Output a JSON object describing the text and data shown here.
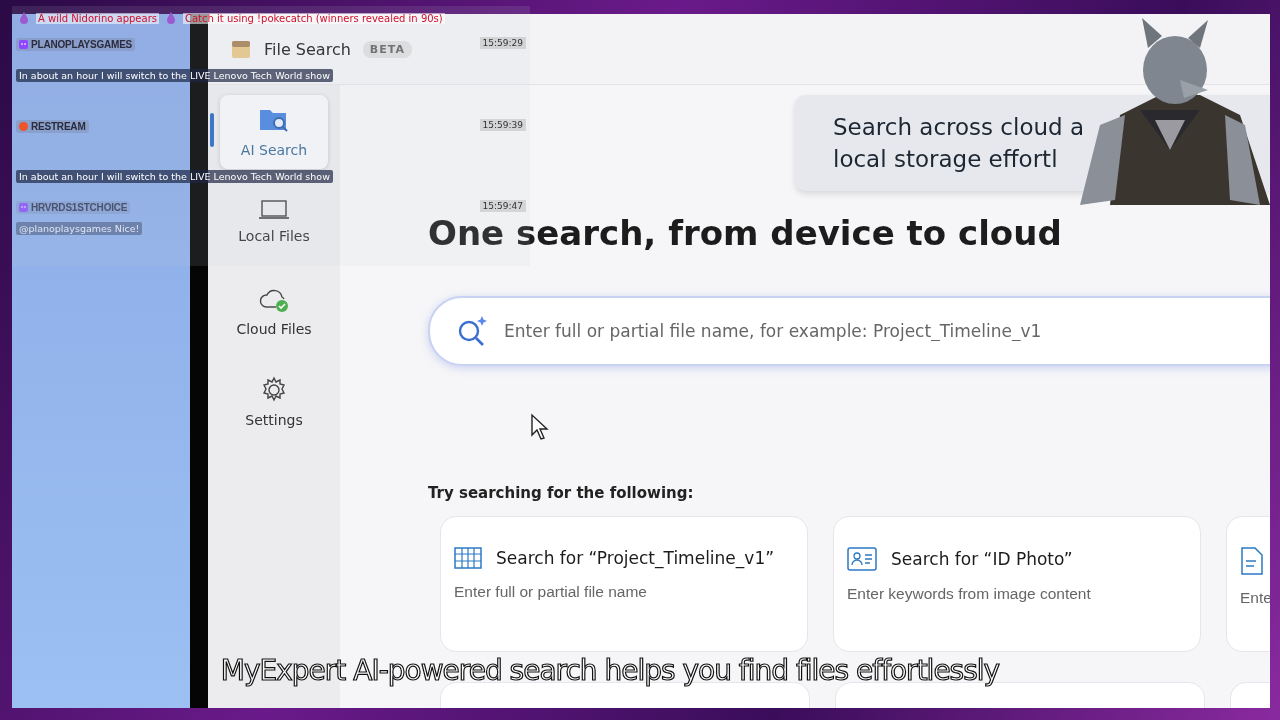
{
  "chat": {
    "alert": {
      "text": "A wild Nidorino appears",
      "text2": "Catch it using !pokecatch (winners revealed in 90s)"
    },
    "messages": [
      {
        "kind": "twitch",
        "user": "PLANOPLAYSGAMES",
        "time": "15:59:29",
        "text": "In about an hour I will switch to the LIVE Lenovo Tech World show",
        "faded": false
      },
      {
        "kind": "restream",
        "user": "RESTREAM",
        "time": "15:59:39",
        "text": "In about an hour I will switch to the LIVE Lenovo Tech World show",
        "faded": false
      },
      {
        "kind": "twitch",
        "user": "HRVRDS1STCHOICE",
        "time": "15:59:47",
        "text": "@planoplaysgames Nice!",
        "faded": true
      }
    ]
  },
  "app": {
    "title": "File Search",
    "badge": "BETA",
    "nav": [
      {
        "kind": "ai",
        "label": "AI Search",
        "selected": true
      },
      {
        "kind": "local",
        "label": "Local Files",
        "selected": false
      },
      {
        "kind": "cloud",
        "label": "Cloud Files",
        "selected": false
      },
      {
        "kind": "settings",
        "label": "Settings",
        "selected": false
      }
    ],
    "hero": [
      "Search across cloud a",
      "local storage effortl"
    ],
    "heading": "One search, from device to cloud",
    "search": {
      "placeholder": "Enter full or partial file name, for example: Project_Timeline_v1"
    },
    "suggestions_label": "Try searching for the following:",
    "suggestions": [
      {
        "kind": "table",
        "title": "Search for “Project_Timeline_v1”",
        "hint": "Enter full or partial file name"
      },
      {
        "kind": "id-card",
        "title": "Search for “ID Photo”",
        "hint": "Enter keywords from image content"
      },
      {
        "kind": "document",
        "hint": "Ente"
      }
    ]
  },
  "caption": "MyExpert AI-powered search helps you find files effortlessly"
}
